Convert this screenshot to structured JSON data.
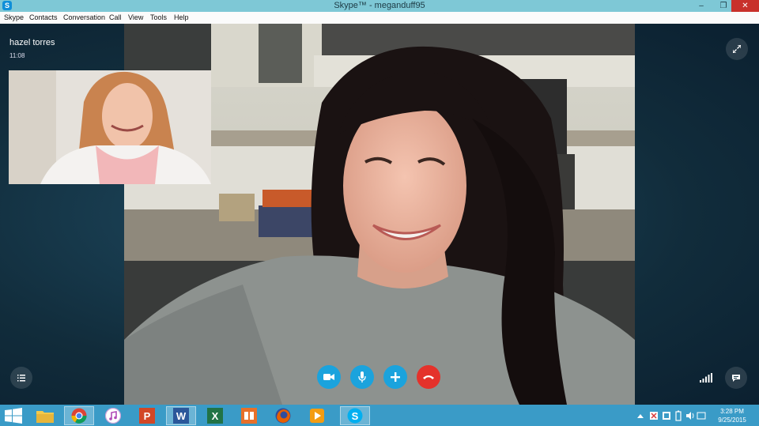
{
  "window": {
    "title": "Skype™ - meganduff95",
    "app_icon": "S"
  },
  "menu": [
    "Skype",
    "Contacts",
    "Conversation",
    "Call",
    "View",
    "Tools",
    "Help"
  ],
  "call": {
    "caller_name": "hazel torres",
    "duration": "11:08"
  },
  "controls": {
    "video": "video-camera-icon",
    "mic": "microphone-icon",
    "add": "plus-icon",
    "end": "hang-up-icon",
    "list": "list-icon",
    "expand": "expand-icon",
    "chat": "chat-bubble-icon",
    "signal": "signal-bars-icon"
  },
  "taskbar": {
    "apps": [
      {
        "name": "file-explorer",
        "active": false
      },
      {
        "name": "chrome",
        "active": true
      },
      {
        "name": "itunes",
        "active": false
      },
      {
        "name": "powerpoint",
        "active": false
      },
      {
        "name": "word",
        "active": true
      },
      {
        "name": "excel",
        "active": false
      },
      {
        "name": "other-app",
        "active": false
      },
      {
        "name": "firefox",
        "active": false
      },
      {
        "name": "media-player",
        "active": false
      },
      {
        "name": "skype",
        "active": true
      }
    ],
    "clock_time": "3:28 PM",
    "clock_date": "9/25/2015"
  },
  "colors": {
    "accent_blue": "#1ba3dd",
    "end_call_red": "#e4322b",
    "taskbar": "#3a9bc7",
    "titlebar": "#7ec8d6"
  }
}
